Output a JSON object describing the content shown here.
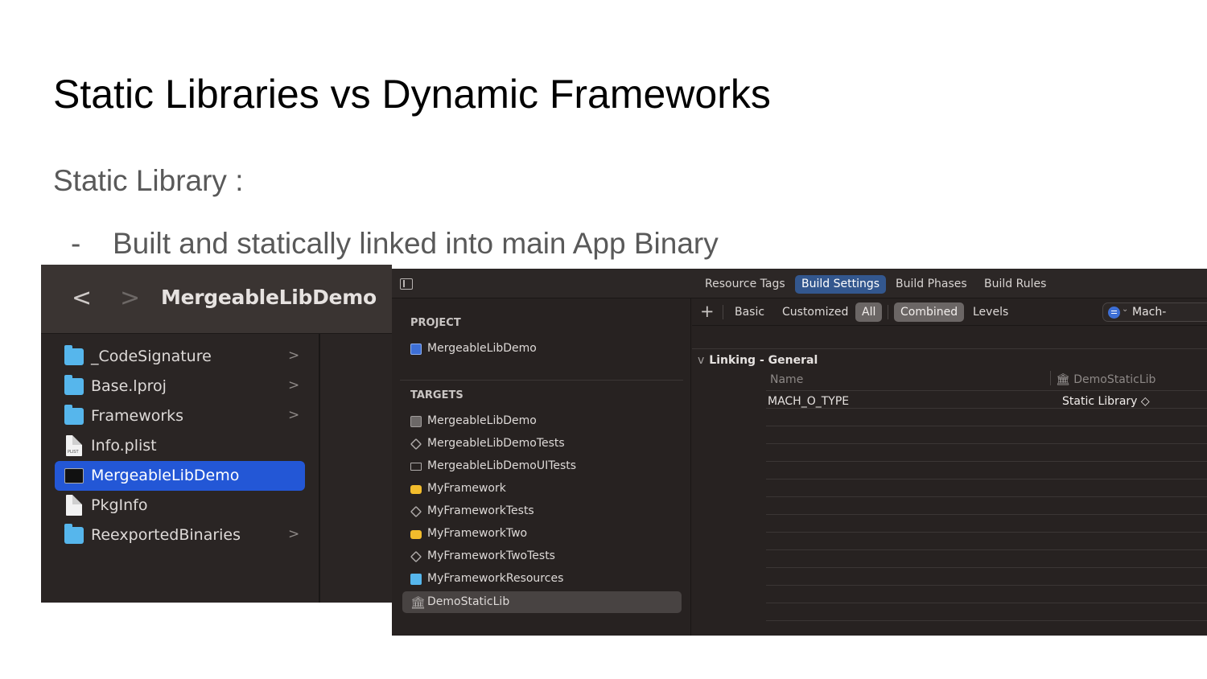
{
  "slide": {
    "title": "Static Libraries vs Dynamic Frameworks",
    "subtitle": "Static Library :",
    "bullet_dash": "-",
    "bullet": "Built and statically linked into main App Binary"
  },
  "finder": {
    "title": "MergeableLibDemo",
    "back": "<",
    "forward": ">",
    "items": [
      {
        "label": "_CodeSignature",
        "icon": "folder-icon",
        "chevron": ">"
      },
      {
        "label": "Base.lproj",
        "icon": "folder-icon",
        "chevron": ">"
      },
      {
        "label": "Frameworks",
        "icon": "folder-icon",
        "chevron": ">"
      },
      {
        "label": "Info.plist",
        "icon": "plist-file-icon",
        "chevron": ""
      },
      {
        "label": "MergeableLibDemo",
        "icon": "executable-icon",
        "chevron": "",
        "selected": true
      },
      {
        "label": "PkgInfo",
        "icon": "document-icon",
        "chevron": ""
      },
      {
        "label": "ReexportedBinaries",
        "icon": "folder-icon",
        "chevron": ">"
      }
    ],
    "plist_badge": "PLIST"
  },
  "xcode": {
    "tabs": [
      "Resource Tags",
      "Build Settings",
      "Build Phases",
      "Build Rules"
    ],
    "active_tab": "Build Settings",
    "project_header": "PROJECT",
    "project": "MergeableLibDemo",
    "targets_header": "TARGETS",
    "targets": [
      {
        "label": "MergeableLibDemo",
        "icon": "app-target-icon"
      },
      {
        "label": "MergeableLibDemoTests",
        "icon": "unit-test-icon"
      },
      {
        "label": "MergeableLibDemoUITests",
        "icon": "ui-test-icon"
      },
      {
        "label": "MyFramework",
        "icon": "framework-icon"
      },
      {
        "label": "MyFrameworkTests",
        "icon": "unit-test-icon"
      },
      {
        "label": "MyFrameworkTwo",
        "icon": "framework-icon"
      },
      {
        "label": "MyFrameworkTwoTests",
        "icon": "unit-test-icon"
      },
      {
        "label": "MyFrameworkResources",
        "icon": "bundle-icon"
      },
      {
        "label": "DemoStaticLib",
        "icon": "static-library-icon",
        "selected": true
      }
    ],
    "filter": {
      "plus": "+",
      "basic": "Basic",
      "customized": "Customized",
      "all": "All",
      "combined": "Combined",
      "levels": "Levels",
      "search_value": "Mach-"
    },
    "group": "Linking - General",
    "group_chevron": "v",
    "col_name": "Name",
    "col_target": "DemoStaticLib",
    "setting_name": "MACH_O_TYPE",
    "setting_value": "Static Library ◇"
  },
  "colors": {
    "selection_blue": "#2357d6",
    "active_tab": "#33578e",
    "finder_bg": "#2a2524",
    "xcode_bg": "#272221"
  }
}
